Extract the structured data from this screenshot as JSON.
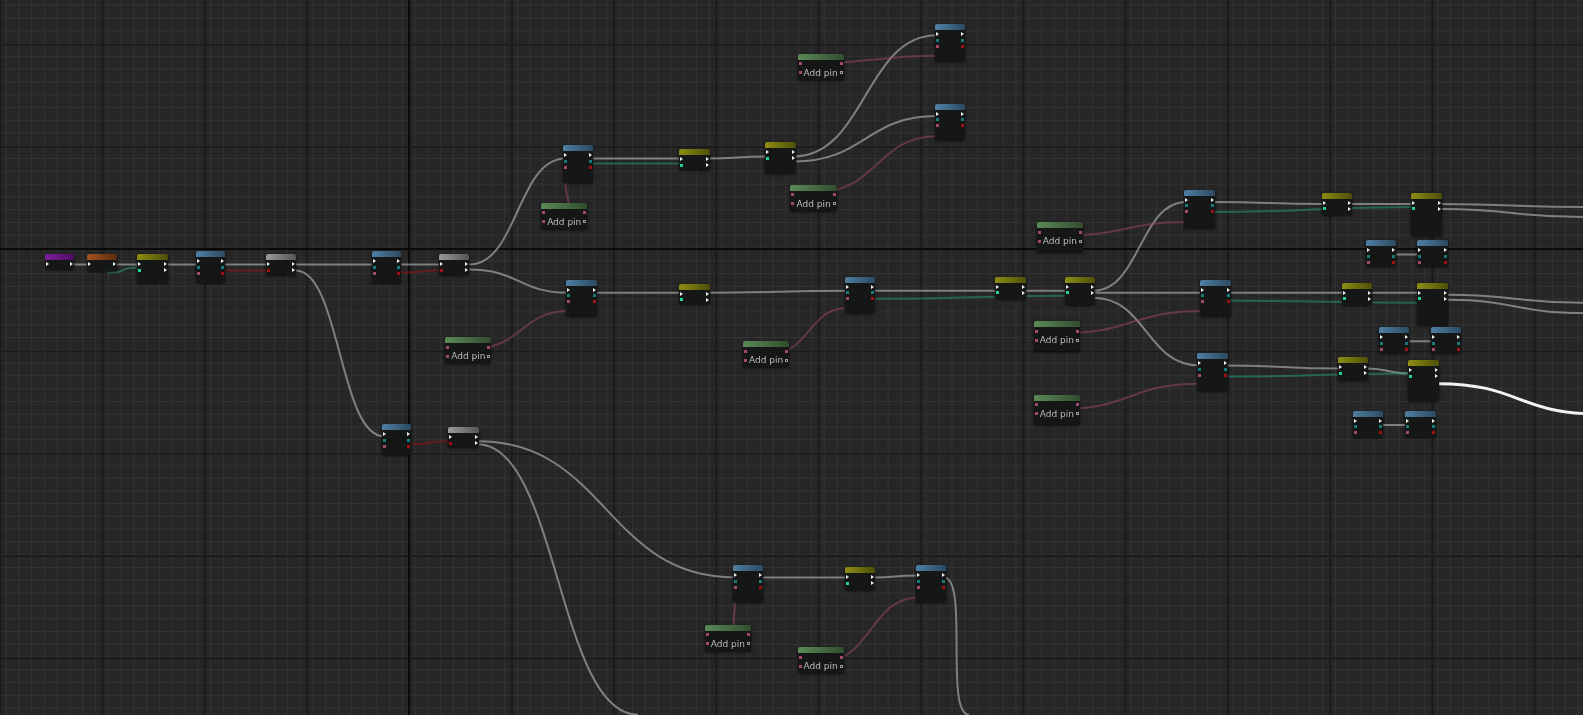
{
  "graph": {
    "nodes": [
      {
        "kind": "event"
      },
      {
        "kind": "macro"
      },
      {
        "kind": "flow"
      },
      {
        "kind": "function"
      },
      {
        "kind": "variable"
      },
      {
        "kind": "function"
      },
      {
        "kind": "variable"
      },
      {
        "kind": "function"
      },
      {
        "kind": "array",
        "label": "Add pin"
      },
      {
        "kind": "flow"
      },
      {
        "kind": "flow"
      },
      {
        "kind": "array",
        "label": "Add pin"
      },
      {
        "kind": "function"
      },
      {
        "kind": "function"
      },
      {
        "kind": "array",
        "label": "Add pin"
      },
      {
        "kind": "function"
      },
      {
        "kind": "array",
        "label": "Add pin"
      },
      {
        "kind": "flow"
      },
      {
        "kind": "array",
        "label": "Add pin"
      },
      {
        "kind": "function"
      },
      {
        "kind": "flow"
      },
      {
        "kind": "flow"
      },
      {
        "kind": "array",
        "label": "Add pin"
      },
      {
        "kind": "function"
      },
      {
        "kind": "flow"
      },
      {
        "kind": "flow"
      },
      {
        "kind": "function"
      },
      {
        "kind": "function"
      },
      {
        "kind": "function"
      },
      {
        "kind": "array",
        "label": "Add pin"
      },
      {
        "kind": "flow"
      },
      {
        "kind": "flow"
      },
      {
        "kind": "function"
      },
      {
        "kind": "function"
      },
      {
        "kind": "function"
      },
      {
        "kind": "array",
        "label": "Add pin"
      },
      {
        "kind": "flow"
      },
      {
        "kind": "flow"
      },
      {
        "kind": "function"
      },
      {
        "kind": "function"
      },
      {
        "kind": "function"
      },
      {
        "kind": "variable"
      },
      {
        "kind": "function"
      },
      {
        "kind": "flow"
      },
      {
        "kind": "function"
      },
      {
        "kind": "array",
        "label": "Add pin"
      },
      {
        "kind": "array",
        "label": "Add pin"
      }
    ]
  }
}
